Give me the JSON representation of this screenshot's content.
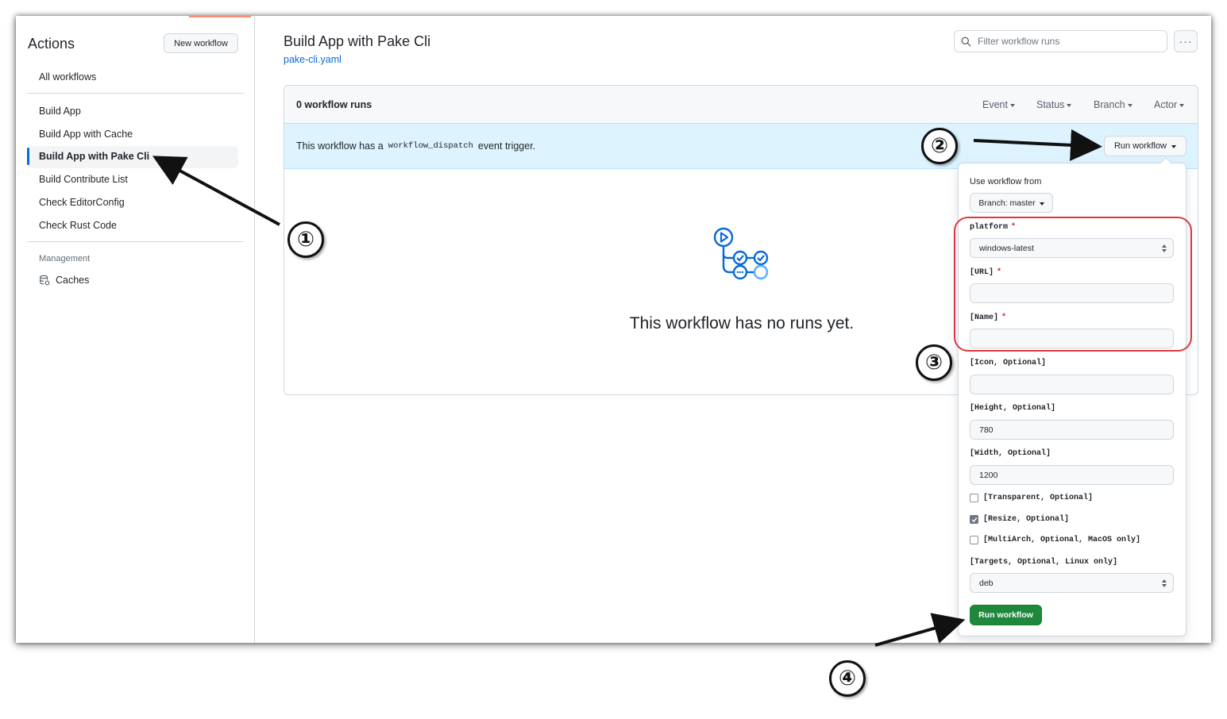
{
  "sidebar": {
    "title": "Actions",
    "new_workflow_label": "New workflow",
    "all_workflows": "All workflows",
    "workflows": [
      {
        "label": "Build App"
      },
      {
        "label": "Build App with Cache"
      },
      {
        "label": "Build App with Pake Cli",
        "active": true
      },
      {
        "label": "Build Contribute List"
      },
      {
        "label": "Check EditorConfig"
      },
      {
        "label": "Check Rust Code"
      }
    ],
    "management_heading": "Management",
    "caches_label": "Caches"
  },
  "header": {
    "title": "Build App with Pake Cli",
    "yaml_link": "pake-cli.yaml",
    "filter_placeholder": "Filter workflow runs",
    "more_icon": "kebab-horizontal-icon"
  },
  "runs": {
    "count_label": "0 workflow runs",
    "filters": [
      "Event",
      "Status",
      "Branch",
      "Actor"
    ],
    "dispatch_prefix": "This workflow has a",
    "dispatch_code": "workflow_dispatch",
    "dispatch_suffix": "event trigger.",
    "run_workflow_label": "Run workflow",
    "empty_message": "This workflow has no runs yet."
  },
  "panel": {
    "use_from_label": "Use workflow from",
    "branch_label": "Branch: master",
    "platform_label": "platform",
    "platform_value": "windows-latest",
    "url_label": "[URL]",
    "url_value": "",
    "name_label": "[Name]",
    "name_value": "",
    "icon_label": "[Icon, Optional]",
    "icon_value": "",
    "height_label": "[Height, Optional]",
    "height_value": "780",
    "width_label": "[Width, Optional]",
    "width_value": "1200",
    "transparent_label": "[Transparent, Optional]",
    "transparent_checked": false,
    "resize_label": "[Resize, Optional]",
    "resize_checked": true,
    "multiarch_label": "[MultiArch, Optional, MacOS only]",
    "multiarch_checked": false,
    "targets_label": "[Targets, Optional, Linux only]",
    "targets_value": "deb",
    "required_marker": "*",
    "submit_label": "Run workflow"
  },
  "annotations": [
    "①",
    "②",
    "③",
    "④"
  ],
  "colors": {
    "accent_blue": "#0969da",
    "primary_green": "#1f883d",
    "info_bg": "#ddf4ff",
    "highlight_red": "#e0363d",
    "required_red": "#cf222e"
  }
}
